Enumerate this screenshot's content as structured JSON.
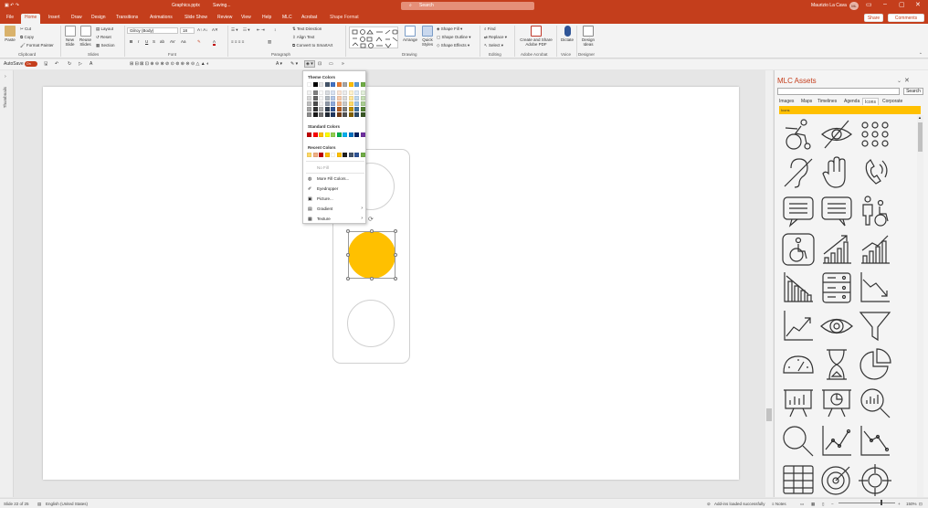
{
  "titlebar": {
    "filename": "Graphics.pptx",
    "save_status": "Saving...",
    "search_placeholder": "Search",
    "user_name": "Maurizio La Cava",
    "user_initials": "ML"
  },
  "tabs": [
    "File",
    "Home",
    "Insert",
    "Draw",
    "Design",
    "Transitions",
    "Animations",
    "Slide Show",
    "Review",
    "View",
    "Help",
    "MLC",
    "Acrobat",
    "Shape Format"
  ],
  "active_tab": "Home",
  "header_buttons": {
    "share": "Share",
    "comments": "Comments"
  },
  "ribbon": {
    "paste": "Paste",
    "cut": "Cut",
    "copy": "Copy",
    "format_painter": "Format Painter",
    "new_slide": "New Slide",
    "reuse_slides": "Reuse Slides",
    "layout": "Layout",
    "reset": "Reset",
    "section": "Section",
    "font_name": "Gilroy (Body)",
    "font_size": "18",
    "text_direction": "Text Direction",
    "align_text": "Align Text",
    "convert_smartart": "Convert to SmartArt",
    "arrange": "Arrange",
    "quick_styles": "Quick Styles",
    "shape_fill": "Shape Fill",
    "shape_outline": "Shape Outline",
    "shape_effects": "Shape Effects",
    "find": "Find",
    "replace": "Replace",
    "select": "Select",
    "create_share_pdf": "Create and Share Adobe PDF",
    "dictate": "Dictate",
    "design_ideas": "Design Ideas",
    "groups": [
      "Clipboard",
      "Slides",
      "Font",
      "Paragraph",
      "Drawing",
      "Editing",
      "Adobe Acrobat",
      "Voice",
      "Designer"
    ]
  },
  "qat": {
    "autosave": "AutoSave",
    "toggle": "On",
    "font_mini": "Gilroy (B"
  },
  "thumbnails_label": "Thumbnails",
  "color_menu": {
    "theme_colors_header": "Theme Colors",
    "standard_colors_header": "Standard Colors",
    "recent_colors_header": "Recent Colors",
    "theme_top": [
      "#ffffff",
      "#000000",
      "#e7e6e6",
      "#44546a",
      "#4472c4",
      "#ed7d31",
      "#a5a5a5",
      "#ffc000",
      "#5b9bd5",
      "#70ad47"
    ],
    "standard": [
      "#c00000",
      "#ff0000",
      "#ffc000",
      "#ffff00",
      "#92d050",
      "#00b050",
      "#00b0f0",
      "#0070c0",
      "#002060",
      "#7030a0"
    ],
    "recent": [
      "#ffd966",
      "#f4b183",
      "#c00000",
      "#ffc000",
      "#ffffff",
      "#ffc000",
      "#1f1f1f",
      "#44546a",
      "#2f5597",
      "#70ad47"
    ],
    "items": {
      "no_fill": "No Fill",
      "more_fill_colors": "More Fill Colors...",
      "eyedropper": "Eyedropper",
      "picture": "Picture...",
      "gradient": "Gradient",
      "texture": "Texture"
    }
  },
  "slide": {
    "selected_fill": "#ffc000"
  },
  "pane": {
    "title": "MLC Assets",
    "search_button": "Search",
    "tabs": [
      "Images",
      "Maps",
      "Timelines",
      "Agenda",
      "Icons",
      "Corporate"
    ],
    "active_tab": "Icons",
    "category": "Icons"
  },
  "status": {
    "slide_info": "Slide 22 of 25",
    "language": "English (United States)",
    "addin_status": "Add-ins loaded successfully",
    "notes": "Notes",
    "zoom": "150%"
  }
}
